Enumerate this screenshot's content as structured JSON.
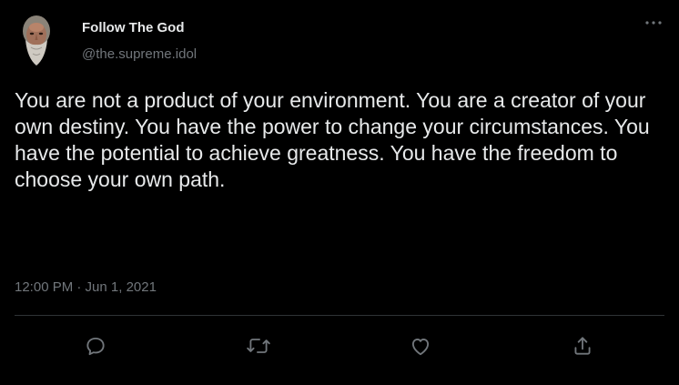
{
  "author": {
    "display_name": "Follow The God",
    "handle": "@the.supreme.idol"
  },
  "tweet": {
    "text": "You are not a product of your environment. You are a creator of your own destiny. You have the power to change your circumstances. You have the potential to achieve greatness. You have the freedom to choose your own path.",
    "timestamp": "12:00 PM · Jun 1, 2021"
  },
  "icons": {
    "more": "more-horizontal-icon",
    "reply": "reply-icon",
    "retweet": "retweet-icon",
    "like": "heart-icon",
    "share": "share-icon"
  },
  "colors": {
    "background": "#000000",
    "text_primary": "#e7e9ea",
    "text_secondary": "#71767b",
    "divider": "#2f3336"
  }
}
